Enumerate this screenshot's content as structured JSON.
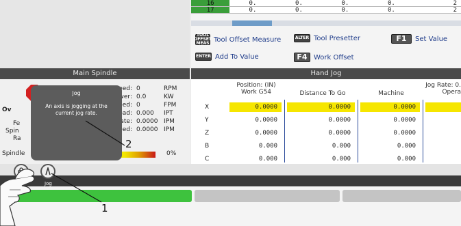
{
  "offsets": {
    "rows": [
      {
        "num": "16",
        "cols": [
          "0.",
          "0.",
          "0.",
          "0.",
          "2"
        ]
      },
      {
        "num": "17",
        "cols": [
          "0.",
          "0.",
          "0.",
          "0.",
          "2"
        ]
      }
    ]
  },
  "fn_buttons": [
    {
      "key": "TOOL OFFSET MEAS",
      "label": "Tool Offset Measure"
    },
    {
      "key": "ALTER",
      "label": "Tool Presetter"
    },
    {
      "key": "F1",
      "label": "Set Value"
    },
    {
      "key": "ENTER",
      "label": "Add To Value"
    },
    {
      "key": "F4",
      "label": "Work Offset"
    }
  ],
  "spindle": {
    "header": "Main Spindle",
    "side_labels": [
      "Ov",
      "Fe",
      "Spin",
      "Ra"
    ],
    "rows": [
      {
        "label": "dle Speed:",
        "value": "0",
        "unit": "RPM"
      },
      {
        "label": "e Power:",
        "value": "0.0",
        "unit": "KW"
      },
      {
        "label": "Speed:",
        "value": "0",
        "unit": "FPM"
      },
      {
        "label": "ip Load:",
        "value": "0.000",
        "unit": "IPT"
      },
      {
        "label": "ed Rate:",
        "value": "0.0000",
        "unit": "IPM"
      },
      {
        "label": "e Feed:",
        "value": "0.0000",
        "unit": "IPM"
      }
    ],
    "bottom_label": "Spindle",
    "load_percent": "0%"
  },
  "tooltip": {
    "title": "Jog",
    "body": "An axis is jogging at the current jog rate."
  },
  "hand_jog": {
    "header": "Hand Jog",
    "col_headers": {
      "position_line1": "Position: (IN)",
      "position_line2": "Work G54",
      "distance": "Distance To Go",
      "machine": "Machine",
      "jog_rate_line1": "Jog Rate: 0.",
      "jog_rate_line2": "Opera"
    },
    "rows": [
      {
        "axis": "X",
        "work": "0.0000",
        "dist": "0.0000",
        "machine": "0.0000",
        "highlight": true
      },
      {
        "axis": "Y",
        "work": "0.0000",
        "dist": "0.0000",
        "machine": "0.0000",
        "highlight": false
      },
      {
        "axis": "Z",
        "work": "0.0000",
        "dist": "0.0000",
        "machine": "0.0000",
        "highlight": false
      },
      {
        "axis": "B",
        "work": "0.000",
        "dist": "0.000",
        "machine": "0.000",
        "highlight": false
      },
      {
        "axis": "C",
        "work": "0.000",
        "dist": "0.000",
        "machine": "0.000",
        "highlight": false
      }
    ]
  },
  "bottom": {
    "jog_label": "Jog"
  },
  "callouts": [
    "1",
    "2"
  ],
  "colors": {
    "header": "#4a4a4a",
    "highlight": "#f6e600",
    "progress": "#3ec23e",
    "stop": "#d32020"
  }
}
